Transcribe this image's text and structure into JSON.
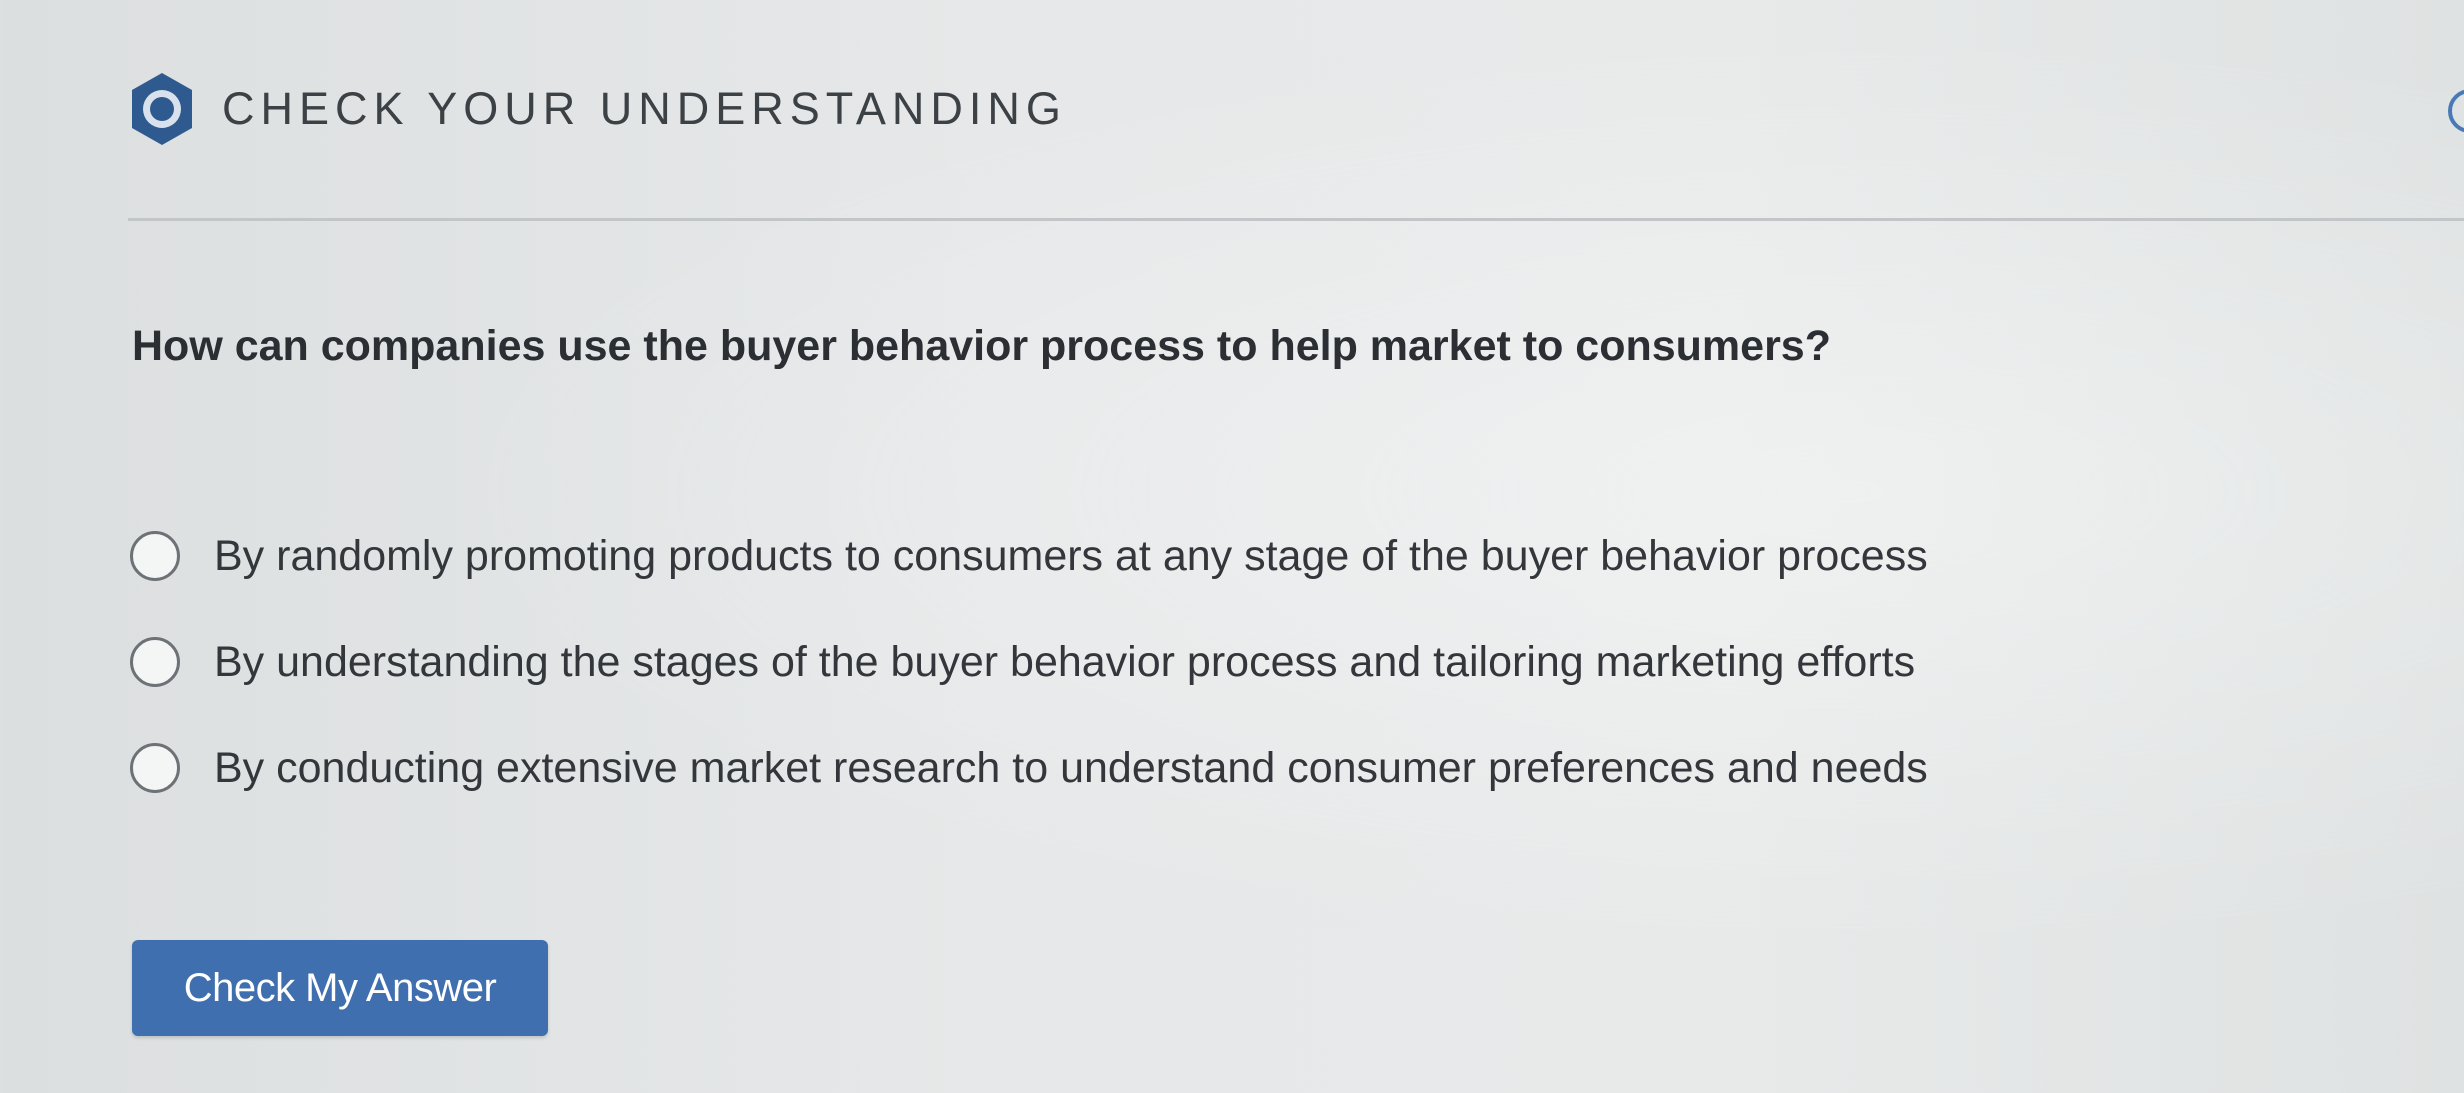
{
  "header": {
    "title": "CHECK YOUR UNDERSTANDING",
    "icon": "hexagon-circle-icon"
  },
  "question": {
    "text": "How can companies use the buyer behavior process to help market to consumers?"
  },
  "options": [
    {
      "label": "By randomly promoting products to consumers at any stage of the buyer behavior process",
      "selected": false
    },
    {
      "label": "By understanding the stages of the buyer behavior process and tailoring marketing efforts",
      "selected": false
    },
    {
      "label": "By conducting extensive market research to understand consumer preferences and needs",
      "selected": false
    }
  ],
  "actions": {
    "check_label": "Check My Answer"
  },
  "colors": {
    "accent": "#3f6fae",
    "icon_fill": "#2f5a8f"
  }
}
